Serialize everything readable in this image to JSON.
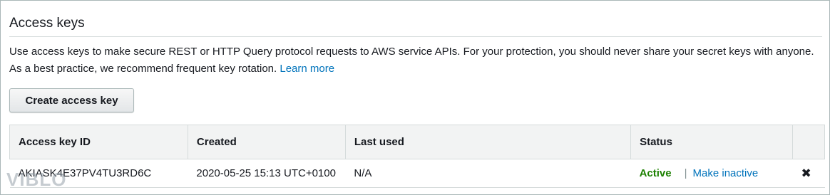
{
  "section": {
    "title": "Access keys",
    "description": "Use access keys to make secure REST or HTTP Query protocol requests to AWS service APIs. For your protection, you should never share your secret keys with anyone. As a best practice, we recommend frequent key rotation.",
    "learn_more": "Learn more"
  },
  "actions": {
    "create_label": "Create access key"
  },
  "table": {
    "columns": [
      "Access key ID",
      "Created",
      "Last used",
      "Status",
      ""
    ],
    "rows": [
      {
        "access_key_id": "AKIASK4E37PV4TU3RD6C",
        "created": "2020-05-25 15:13 UTC+0100",
        "last_used": "N/A",
        "status": "Active",
        "status_action": "Make inactive",
        "delete_icon": "close-x-icon"
      }
    ]
  },
  "watermark": "VIBLO",
  "colors": {
    "link": "#0073bb",
    "active": "#1d8102",
    "header_bg": "#f2f3f3"
  }
}
